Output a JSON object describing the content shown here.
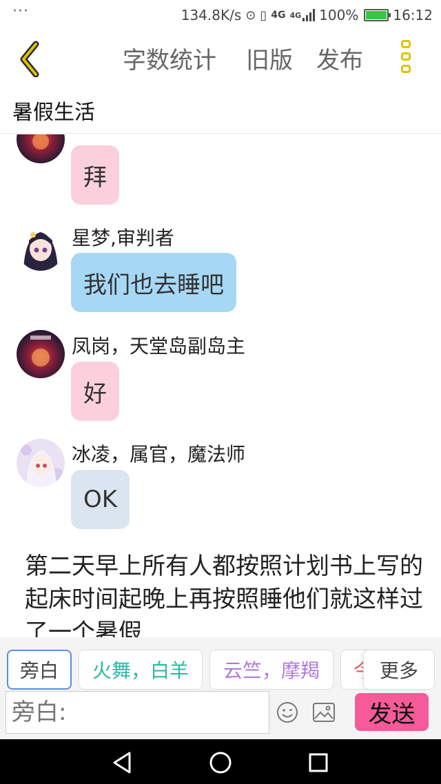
{
  "status": {
    "dots": "···",
    "speed": "134.8K/s",
    "signal_left": "4G",
    "signal_right": "4G",
    "battery": "100%",
    "time": "16:12"
  },
  "toolbar": {
    "word_count": "字数统计",
    "old_version": "旧版",
    "publish": "发布"
  },
  "title": "暑假生活",
  "messages": [
    {
      "sender": "",
      "text": "拜",
      "bubble": "pink"
    },
    {
      "sender": "星梦,审判者",
      "text": "我们也去睡吧",
      "bubble": "blue"
    },
    {
      "sender": "凤岗，天堂岛副岛主",
      "text": "好",
      "bubble": "pink"
    },
    {
      "sender": "冰凌，属官，魔法师",
      "text": "OK",
      "bubble": "grey"
    }
  ],
  "narration": "第二天早上所有人都按照计划书上写的起床时间起晚上再按照睡他们就这样过了一个暑假",
  "roles": [
    "旁白",
    "火舞，白羊",
    "云竺，摩羯",
    "今"
  ],
  "more": "更多",
  "input": {
    "placeholder": "旁白:"
  },
  "send": "发送",
  "colors": {
    "accent_yellow": "#e2c200",
    "send_pink": "#f45b98",
    "bubble_pink": "#fbd0dc",
    "bubble_blue": "#a6d8f5",
    "bubble_grey": "#dbe5ef"
  }
}
